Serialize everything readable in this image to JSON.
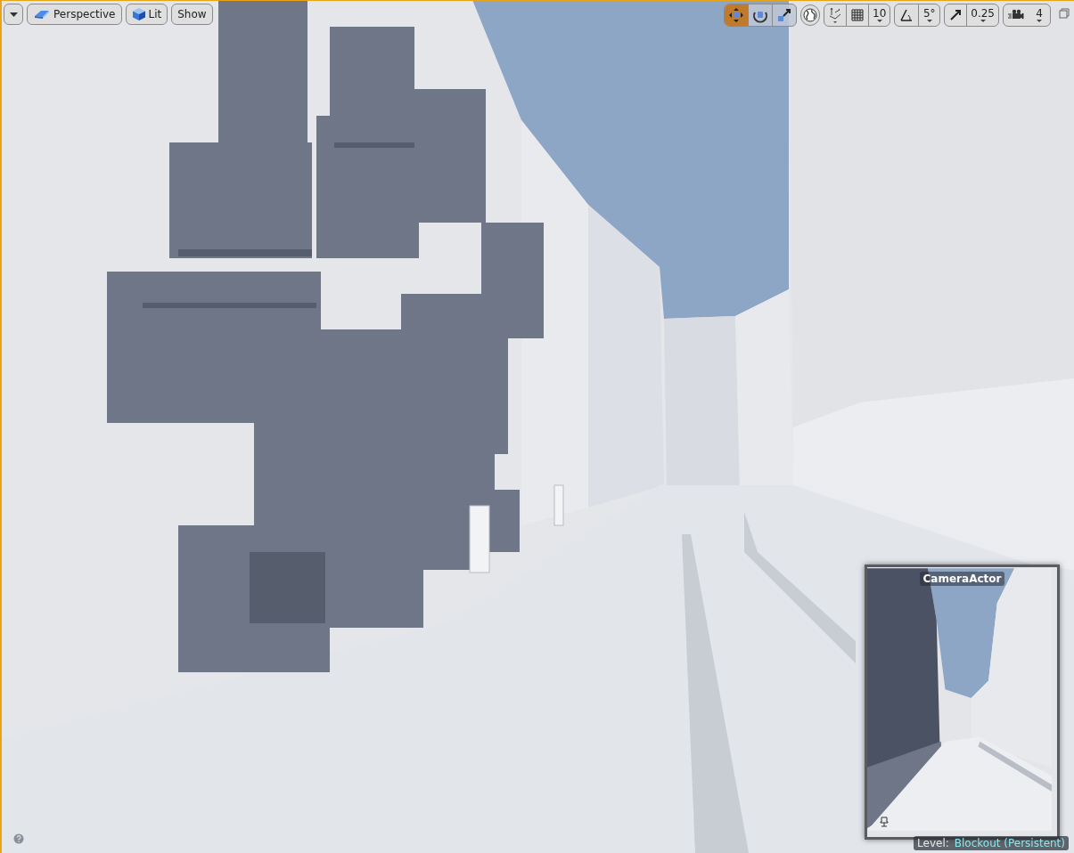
{
  "viewport": {
    "view_buttons": [
      {
        "label": "Perspective",
        "kind": "perspective"
      },
      {
        "label": "Lit",
        "kind": "lit"
      },
      {
        "label": "Show",
        "kind": "plain"
      }
    ],
    "transform_tools": [
      {
        "kind": "translate",
        "selected": true
      },
      {
        "kind": "rotate",
        "selected": false
      },
      {
        "kind": "scale",
        "selected": false
      }
    ],
    "snap_settings": [
      {
        "kind": "grid",
        "value": "10"
      },
      {
        "kind": "angle",
        "value": "5°"
      },
      {
        "kind": "scale",
        "value": "0.25"
      },
      {
        "kind": "camera-speed",
        "value": "4"
      }
    ],
    "camera_preview": {
      "title": "CameraActor"
    },
    "level": {
      "label": "Level:",
      "name": "Blockout (Persistent)"
    }
  }
}
